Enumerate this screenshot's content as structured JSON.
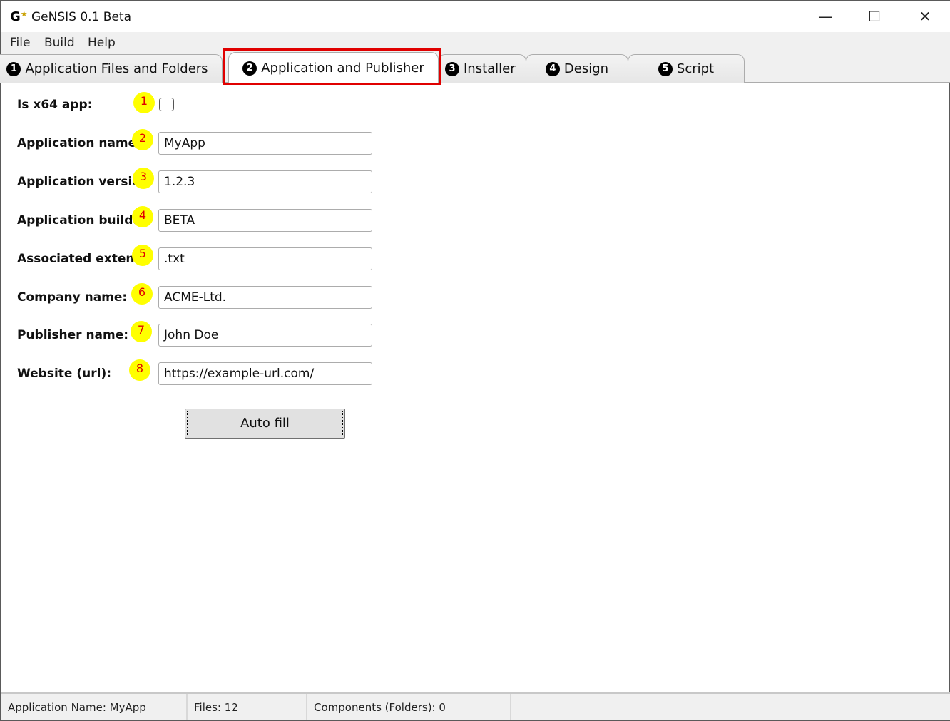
{
  "window": {
    "logo": "G",
    "title": "GeNSIS 0.1 Beta",
    "minimize": "—",
    "maximize": "☐",
    "close": "✕"
  },
  "menu": [
    "File",
    "Build",
    "Help"
  ],
  "tabs": [
    {
      "num": "1",
      "label": "Application Files and Folders"
    },
    {
      "num": "2",
      "label": "Application and Publisher"
    },
    {
      "num": "3",
      "label": "Installer"
    },
    {
      "num": "4",
      "label": "Design"
    },
    {
      "num": "5",
      "label": "Script"
    }
  ],
  "form": {
    "is_x64": {
      "label": "Is x64 app:",
      "badge": "1",
      "checked": false
    },
    "fields": [
      {
        "label": "Application name:",
        "badge": "2",
        "value": "MyApp"
      },
      {
        "label": "Application version:",
        "badge": "3",
        "value": "1.2.3"
      },
      {
        "label": "Application build:",
        "badge": "4",
        "value": "BETA"
      },
      {
        "label": "Associated extension:",
        "badge": "5",
        "value": ".txt"
      },
      {
        "label": "Company name:",
        "badge": "6",
        "value": "ACME-Ltd."
      },
      {
        "label": "Publisher name:",
        "badge": "7",
        "value": "John Doe"
      },
      {
        "label": "Website (url):",
        "badge": "8",
        "value": "https://example-url.com/"
      }
    ],
    "auto_fill": "Auto fill"
  },
  "status": [
    "Application Name:  MyApp",
    "Files:  12",
    "Components (Folders):  0"
  ]
}
